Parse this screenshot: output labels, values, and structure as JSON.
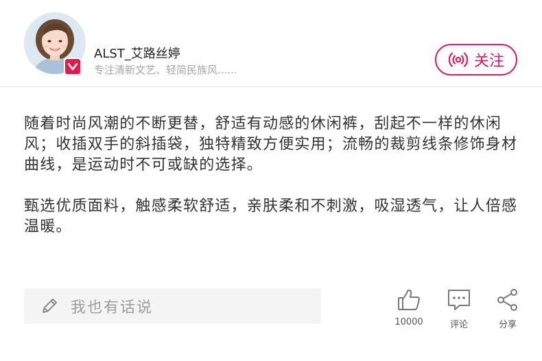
{
  "header": {
    "user": {
      "name": "ALST_艾路丝婷",
      "bio": "专注清新文艺、轻简民族风......",
      "avatar_icon": "avatar-photo",
      "badge_icon": "v-verified-icon"
    },
    "follow_button": {
      "label": "关注",
      "icon": "broadcast-icon",
      "color": "#e0195a"
    }
  },
  "content": {
    "paragraphs": [
      "随着时尚风潮的不断更替，舒适有动感的休闲裤，刮起不一样的休闲风；收插双手的斜插袋，独特精致方便实用；流畅的裁剪线条修饰身材曲线，是运动时不可或缺的选择。",
      "甄选优质面料，触感柔软舒适，亲肤柔和不刺激，吸湿透气，让人倍感温暖。"
    ]
  },
  "footer": {
    "comment_input": {
      "placeholder": "我也有话说",
      "icon": "pencil-icon"
    },
    "actions": {
      "like": {
        "icon": "thumbs-up-icon",
        "label": "10000"
      },
      "comment": {
        "icon": "comment-bubble-icon",
        "label": "评论"
      },
      "share": {
        "icon": "share-icon",
        "label": "分享"
      }
    }
  }
}
